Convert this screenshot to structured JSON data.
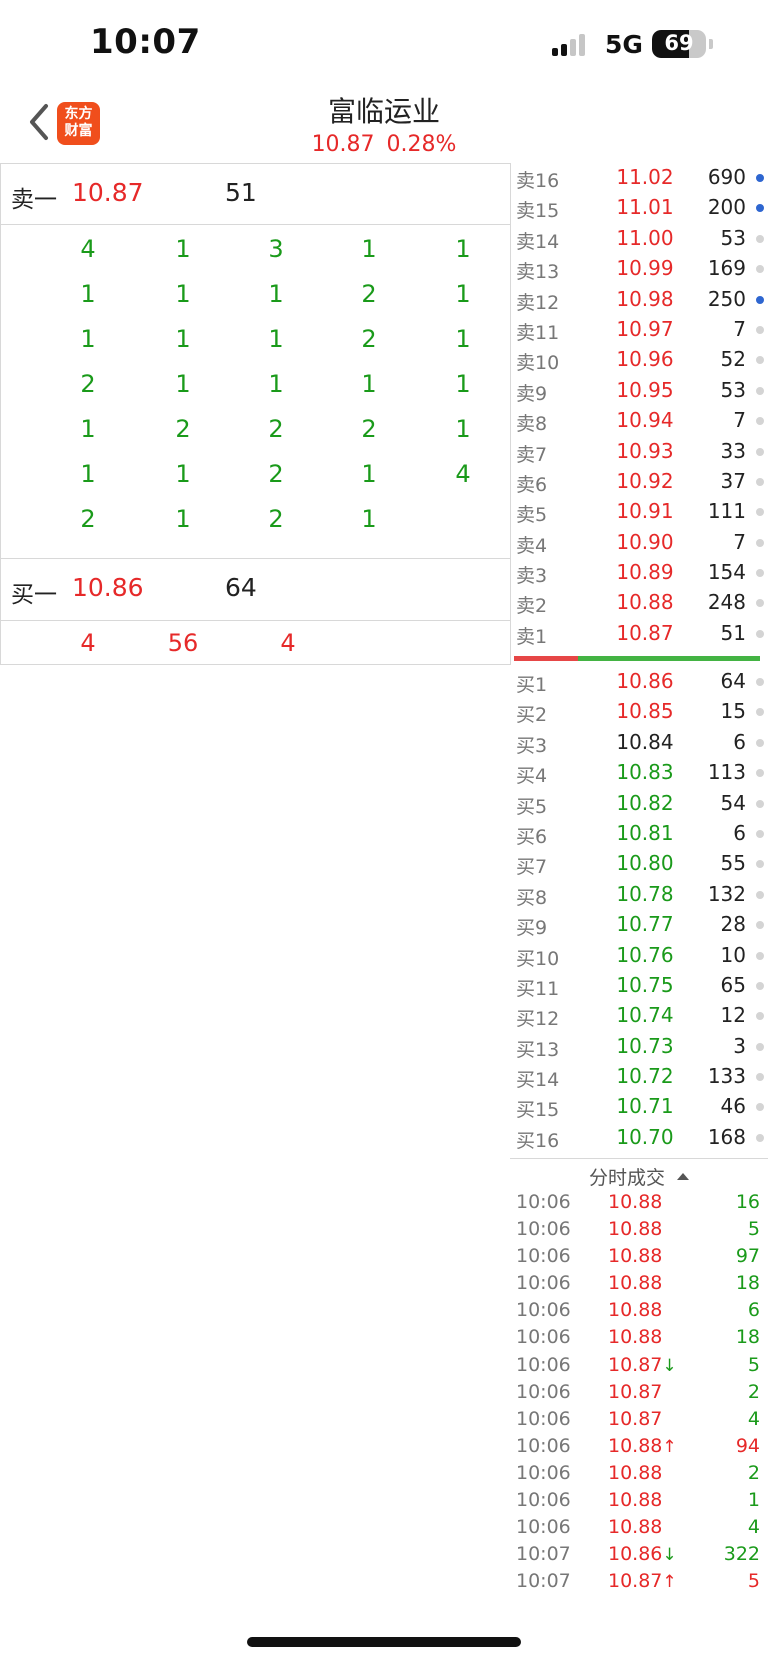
{
  "status_bar": {
    "time": "10:07",
    "network": "5G",
    "battery": "69",
    "battery_level": 0.69
  },
  "header": {
    "logo_line1": "东方",
    "logo_line2": "财富",
    "title": "富临运业",
    "price": "10.87",
    "change_pct": "0.28%"
  },
  "level1": {
    "ask": {
      "label": "卖一",
      "price": "10.87",
      "qty": "51"
    },
    "ask_queue": [
      [
        "4",
        "1",
        "3",
        "1",
        "1"
      ],
      [
        "1",
        "1",
        "1",
        "2",
        "1"
      ],
      [
        "1",
        "1",
        "1",
        "2",
        "1"
      ],
      [
        "2",
        "1",
        "1",
        "1",
        "1"
      ],
      [
        "1",
        "2",
        "2",
        "2",
        "1"
      ],
      [
        "1",
        "1",
        "2",
        "1",
        "4"
      ],
      [
        "2",
        "1",
        "2",
        "1",
        ""
      ]
    ],
    "bid": {
      "label": "买一",
      "price": "10.86",
      "qty": "64"
    },
    "bid_queue": [
      "4",
      "56",
      "4"
    ]
  },
  "asks": [
    {
      "label": "卖16",
      "price": "11.02",
      "qty": "690",
      "dot": "blue",
      "color": "red"
    },
    {
      "label": "卖15",
      "price": "11.01",
      "qty": "200",
      "dot": "blue",
      "color": "red"
    },
    {
      "label": "卖14",
      "price": "11.00",
      "qty": "53",
      "dot": "gray",
      "color": "red"
    },
    {
      "label": "卖13",
      "price": "10.99",
      "qty": "169",
      "dot": "gray",
      "color": "red"
    },
    {
      "label": "卖12",
      "price": "10.98",
      "qty": "250",
      "dot": "blue",
      "color": "red"
    },
    {
      "label": "卖11",
      "price": "10.97",
      "qty": "7",
      "dot": "gray",
      "color": "red"
    },
    {
      "label": "卖10",
      "price": "10.96",
      "qty": "52",
      "dot": "gray",
      "color": "red"
    },
    {
      "label": "卖9",
      "price": "10.95",
      "qty": "53",
      "dot": "gray",
      "color": "red"
    },
    {
      "label": "卖8",
      "price": "10.94",
      "qty": "7",
      "dot": "gray",
      "color": "red"
    },
    {
      "label": "卖7",
      "price": "10.93",
      "qty": "33",
      "dot": "gray",
      "color": "red"
    },
    {
      "label": "卖6",
      "price": "10.92",
      "qty": "37",
      "dot": "gray",
      "color": "red"
    },
    {
      "label": "卖5",
      "price": "10.91",
      "qty": "111",
      "dot": "gray",
      "color": "red"
    },
    {
      "label": "卖4",
      "price": "10.90",
      "qty": "7",
      "dot": "gray",
      "color": "red"
    },
    {
      "label": "卖3",
      "price": "10.89",
      "qty": "154",
      "dot": "gray",
      "color": "red"
    },
    {
      "label": "卖2",
      "price": "10.88",
      "qty": "248",
      "dot": "gray",
      "color": "red"
    },
    {
      "label": "卖1",
      "price": "10.87",
      "qty": "51",
      "dot": "gray",
      "color": "red"
    }
  ],
  "bids": [
    {
      "label": "买1",
      "price": "10.86",
      "qty": "64",
      "dot": "gray",
      "color": "red"
    },
    {
      "label": "买2",
      "price": "10.85",
      "qty": "15",
      "dot": "gray",
      "color": "red"
    },
    {
      "label": "买3",
      "price": "10.84",
      "qty": "6",
      "dot": "gray",
      "color": "dark"
    },
    {
      "label": "买4",
      "price": "10.83",
      "qty": "113",
      "dot": "gray",
      "color": "green"
    },
    {
      "label": "买5",
      "price": "10.82",
      "qty": "54",
      "dot": "gray",
      "color": "green"
    },
    {
      "label": "买6",
      "price": "10.81",
      "qty": "6",
      "dot": "gray",
      "color": "green"
    },
    {
      "label": "买7",
      "price": "10.80",
      "qty": "55",
      "dot": "gray",
      "color": "green"
    },
    {
      "label": "买8",
      "price": "10.78",
      "qty": "132",
      "dot": "gray",
      "color": "green"
    },
    {
      "label": "买9",
      "price": "10.77",
      "qty": "28",
      "dot": "gray",
      "color": "green"
    },
    {
      "label": "买10",
      "price": "10.76",
      "qty": "10",
      "dot": "gray",
      "color": "green"
    },
    {
      "label": "买11",
      "price": "10.75",
      "qty": "65",
      "dot": "gray",
      "color": "green"
    },
    {
      "label": "买12",
      "price": "10.74",
      "qty": "12",
      "dot": "gray",
      "color": "green"
    },
    {
      "label": "买13",
      "price": "10.73",
      "qty": "3",
      "dot": "gray",
      "color": "green"
    },
    {
      "label": "买14",
      "price": "10.72",
      "qty": "133",
      "dot": "gray",
      "color": "green"
    },
    {
      "label": "买15",
      "price": "10.71",
      "qty": "46",
      "dot": "gray",
      "color": "green"
    },
    {
      "label": "买16",
      "price": "10.70",
      "qty": "168",
      "dot": "gray",
      "color": "green"
    }
  ],
  "trades_title": "分时成交",
  "trades": [
    {
      "time": "10:06",
      "price": "10.88",
      "arrow": "",
      "vol": "16",
      "vol_color": "green"
    },
    {
      "time": "10:06",
      "price": "10.88",
      "arrow": "",
      "vol": "5",
      "vol_color": "green"
    },
    {
      "time": "10:06",
      "price": "10.88",
      "arrow": "",
      "vol": "97",
      "vol_color": "green"
    },
    {
      "time": "10:06",
      "price": "10.88",
      "arrow": "",
      "vol": "18",
      "vol_color": "green"
    },
    {
      "time": "10:06",
      "price": "10.88",
      "arrow": "",
      "vol": "6",
      "vol_color": "green"
    },
    {
      "time": "10:06",
      "price": "10.88",
      "arrow": "",
      "vol": "18",
      "vol_color": "green"
    },
    {
      "time": "10:06",
      "price": "10.87",
      "arrow": "↓",
      "vol": "5",
      "vol_color": "green"
    },
    {
      "time": "10:06",
      "price": "10.87",
      "arrow": "",
      "vol": "2",
      "vol_color": "green"
    },
    {
      "time": "10:06",
      "price": "10.87",
      "arrow": "",
      "vol": "4",
      "vol_color": "green"
    },
    {
      "time": "10:06",
      "price": "10.88",
      "arrow": "↑",
      "vol": "94",
      "vol_color": "red"
    },
    {
      "time": "10:06",
      "price": "10.88",
      "arrow": "",
      "vol": "2",
      "vol_color": "green"
    },
    {
      "time": "10:06",
      "price": "10.88",
      "arrow": "",
      "vol": "1",
      "vol_color": "green"
    },
    {
      "time": "10:06",
      "price": "10.88",
      "arrow": "",
      "vol": "4",
      "vol_color": "green"
    },
    {
      "time": "10:07",
      "price": "10.86",
      "arrow": "↓",
      "vol": "322",
      "vol_color": "green"
    },
    {
      "time": "10:07",
      "price": "10.87",
      "arrow": "↑",
      "vol": "5",
      "vol_color": "red"
    }
  ]
}
